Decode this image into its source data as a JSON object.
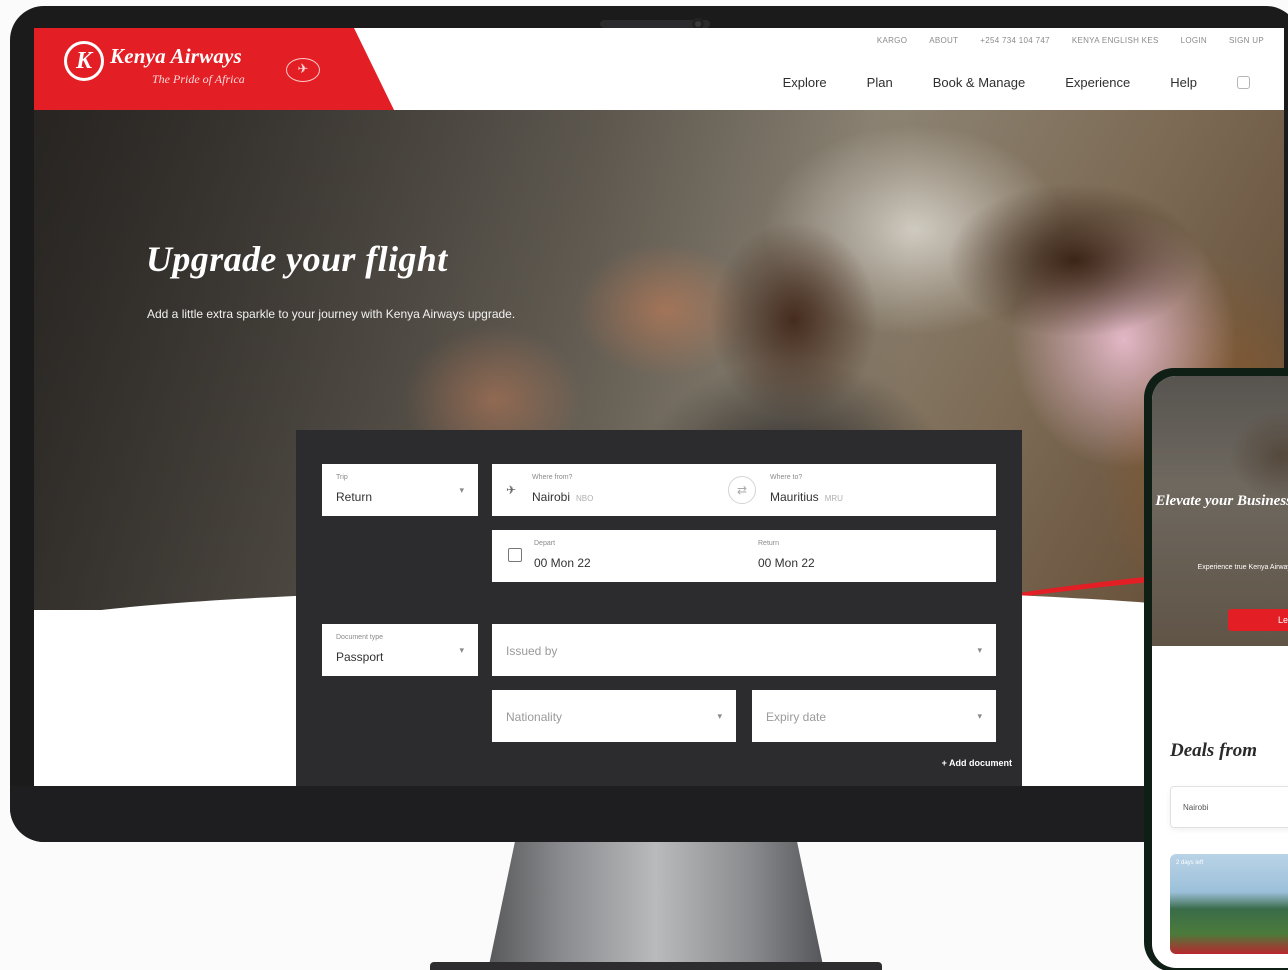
{
  "header": {
    "brand": "Kenya Airways",
    "tagline": "The Pride of Africa",
    "top_links": [
      "KARGO",
      "ABOUT",
      "+254 734 104 747",
      "KENYA ENGLISH KES",
      "LOGIN",
      "SIGN UP"
    ],
    "nav": [
      "Explore",
      "Plan",
      "Book & Manage",
      "Experience",
      "Help"
    ]
  },
  "hero": {
    "title": "Upgrade your flight",
    "subtitle": "Add a little extra sparkle to your journey with Kenya Airways upgrade."
  },
  "booking": {
    "trip": {
      "label": "Trip",
      "value": "Return"
    },
    "from": {
      "label": "Where from?",
      "value": "Nairobi",
      "code": "NBO"
    },
    "to": {
      "label": "Where to?",
      "value": "Mauritius",
      "code": "MRU"
    },
    "depart": {
      "label": "Depart",
      "value": "00 Mon 22"
    },
    "return": {
      "label": "Return",
      "value": "00 Mon 22"
    },
    "document_type": {
      "label": "Document type",
      "value": "Passport"
    },
    "issued_by": {
      "placeholder": "Issued by"
    },
    "nationality": {
      "placeholder": "Nationality"
    },
    "expiry_date": {
      "placeholder": "Expiry date"
    },
    "add_document": "+ Add document"
  },
  "phone": {
    "hero_title": "Elevate your Business",
    "hero_text": "Experience true Kenya Airways",
    "cta": "Learn",
    "deals_title": "Deals from",
    "origin_select": "Nairobi",
    "deal_date": "2 days left"
  },
  "colors": {
    "brand_red": "#e31e24",
    "panel_dark": "#2c2c2e"
  }
}
